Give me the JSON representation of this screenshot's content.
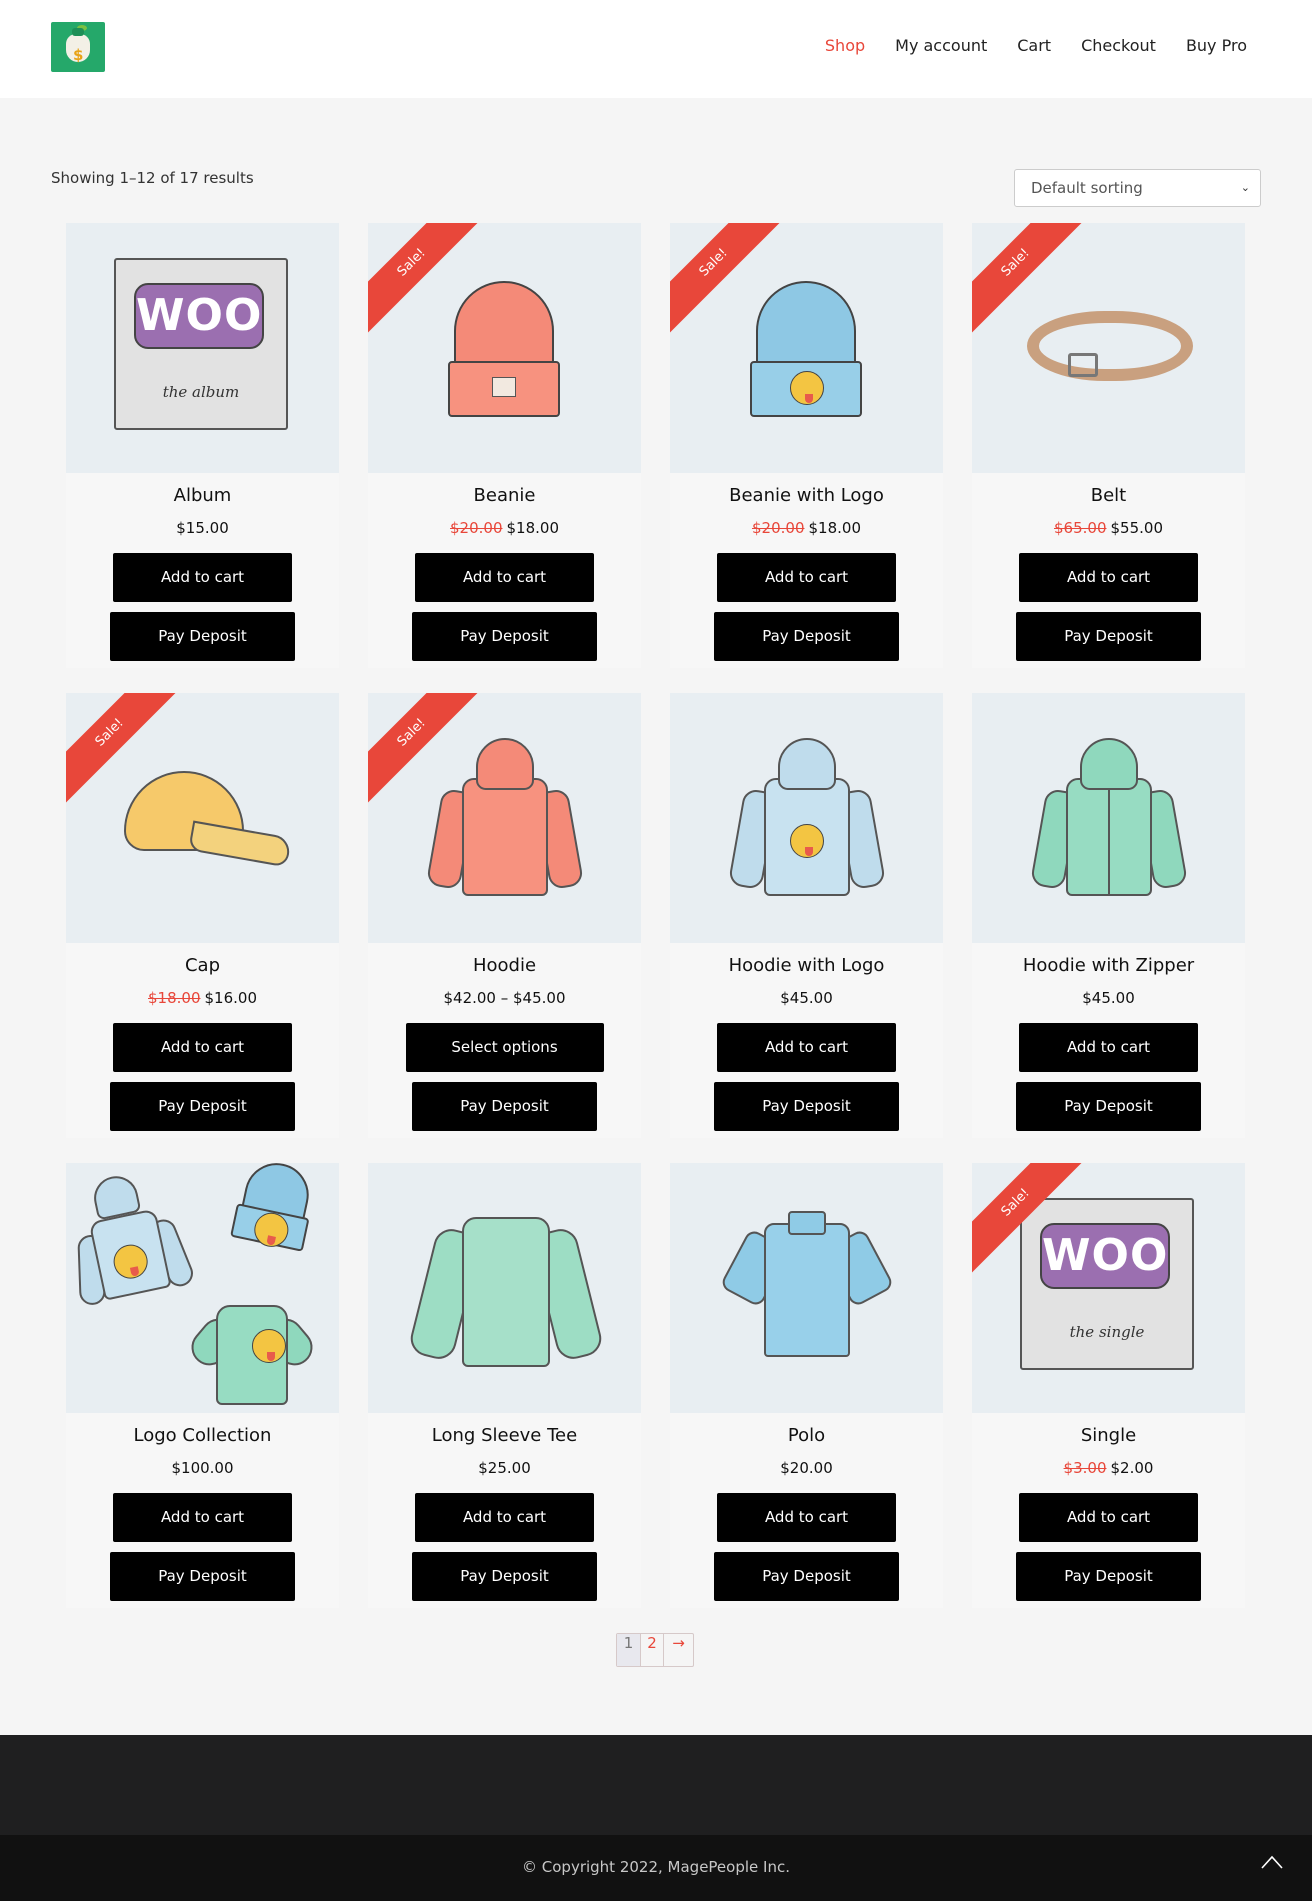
{
  "header": {
    "logo_alt": "money bag logo",
    "nav": [
      {
        "label": "Shop",
        "active": true
      },
      {
        "label": "My account",
        "active": false
      },
      {
        "label": "Cart",
        "active": false
      },
      {
        "label": "Checkout",
        "active": false
      },
      {
        "label": "Buy Pro",
        "active": false
      }
    ]
  },
  "toolbar": {
    "result_count": "Showing 1–12 of 17 results",
    "sort_value": "Default sorting"
  },
  "products": [
    {
      "name": "Album",
      "price": "$15.00",
      "old_price": "",
      "sale": false,
      "cart_label": "Add to cart",
      "deposit_label": "Pay Deposit"
    },
    {
      "name": "Beanie",
      "price": "$18.00",
      "old_price": "$20.00",
      "sale": true,
      "cart_label": "Add to cart",
      "deposit_label": "Pay Deposit"
    },
    {
      "name": "Beanie with Logo",
      "price": "$18.00",
      "old_price": "$20.00",
      "sale": true,
      "cart_label": "Add to cart",
      "deposit_label": "Pay Deposit"
    },
    {
      "name": "Belt",
      "price": "$55.00",
      "old_price": "$65.00",
      "sale": true,
      "cart_label": "Add to cart",
      "deposit_label": "Pay Deposit"
    },
    {
      "name": "Cap",
      "price": "$16.00",
      "old_price": "$18.00",
      "sale": true,
      "cart_label": "Add to cart",
      "deposit_label": "Pay Deposit"
    },
    {
      "name": "Hoodie",
      "price": "$42.00 – $45.00",
      "old_price": "",
      "sale": true,
      "cart_label": "Select options",
      "deposit_label": "Pay Deposit"
    },
    {
      "name": "Hoodie with Logo",
      "price": "$45.00",
      "old_price": "",
      "sale": false,
      "cart_label": "Add to cart",
      "deposit_label": "Pay Deposit"
    },
    {
      "name": "Hoodie with Zipper",
      "price": "$45.00",
      "old_price": "",
      "sale": false,
      "cart_label": "Add to cart",
      "deposit_label": "Pay Deposit"
    },
    {
      "name": "Logo Collection",
      "price": "$100.00",
      "old_price": "",
      "sale": false,
      "cart_label": "Add to cart",
      "deposit_label": "Pay Deposit"
    },
    {
      "name": "Long Sleeve Tee",
      "price": "$25.00",
      "old_price": "",
      "sale": false,
      "cart_label": "Add to cart",
      "deposit_label": "Pay Deposit"
    },
    {
      "name": "Polo",
      "price": "$20.00",
      "old_price": "",
      "sale": false,
      "cart_label": "Add to cart",
      "deposit_label": "Pay Deposit"
    },
    {
      "name": "Single",
      "price": "$2.00",
      "old_price": "$3.00",
      "sale": true,
      "cart_label": "Add to cart",
      "deposit_label": "Pay Deposit"
    }
  ],
  "product_images": [
    "album",
    "beanie",
    "beanie-with-logo",
    "belt",
    "cap",
    "hoodie",
    "hoodie-with-logo",
    "hoodie-with-zipper",
    "logo-collection",
    "long-sleeve-tee",
    "polo",
    "single"
  ],
  "sale_badge": "Sale!",
  "art_text": {
    "woo": "WOO",
    "album_sub": "the album",
    "single_sub": "the single"
  },
  "pagination": {
    "current": "1",
    "page2": "2",
    "next": "→"
  },
  "footer": {
    "copyright": "© Copyright 2022, MagePeople Inc.",
    "scroll_top_icon": "chevron-up-icon"
  },
  "colors": {
    "accent": "#e8473a",
    "button": "#000000",
    "footer_top": "#1f1f20",
    "footer_bottom": "#111111",
    "logo_bg": "#25a86a"
  }
}
